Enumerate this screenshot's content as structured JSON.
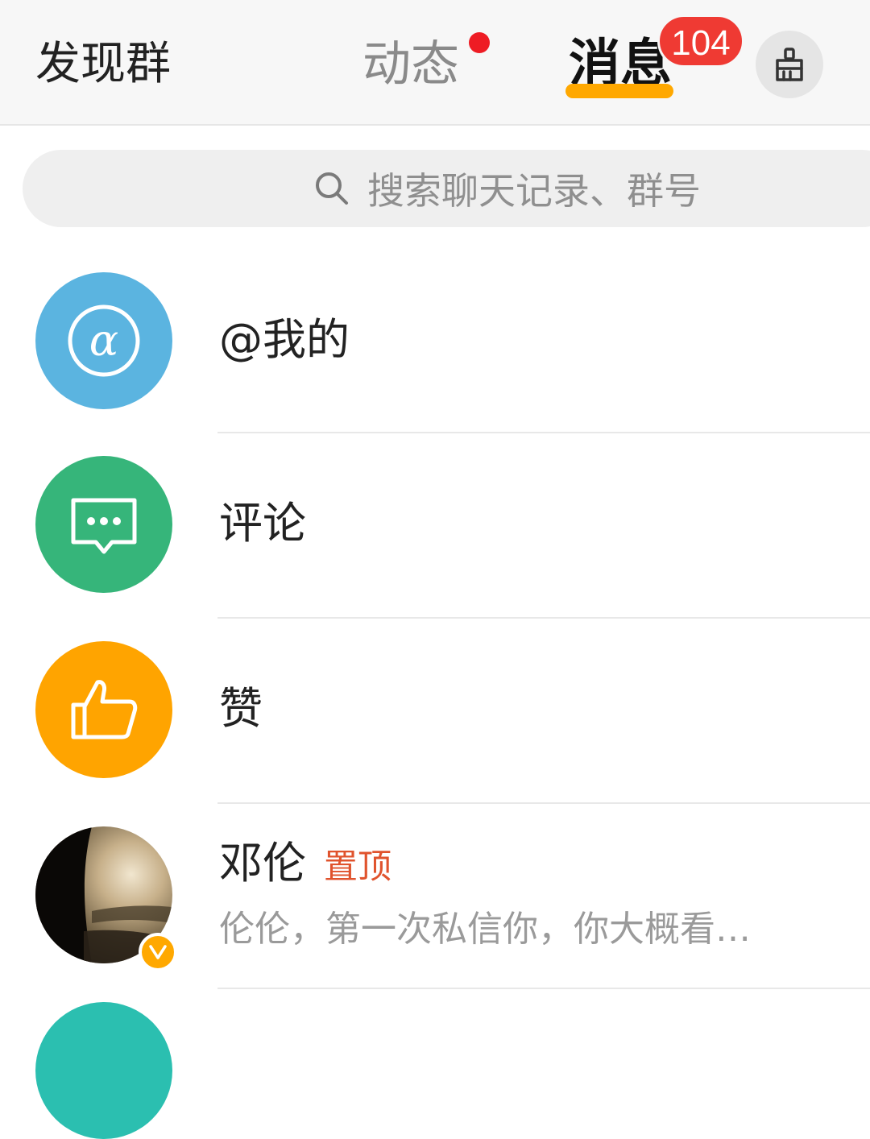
{
  "header": {
    "discover_label": "发现群",
    "tabs": [
      {
        "label": "动态",
        "has_dot": true
      },
      {
        "label": "消息",
        "selected": true,
        "badge": "104"
      }
    ],
    "clean_button_icon": "broom-icon"
  },
  "search": {
    "placeholder": "搜索聊天记录、群号",
    "icon": "search-icon"
  },
  "list": {
    "items": [
      {
        "title": "@我的",
        "icon": "at-icon",
        "color": "#5bb4e0"
      },
      {
        "title": "评论",
        "icon": "comment-icon",
        "color": "#36b57a"
      },
      {
        "title": "赞",
        "icon": "thumbs-up-icon",
        "color": "#ffa400"
      },
      {
        "title": "邓伦",
        "tag": "置顶",
        "preview": "伦伦，第一次私信你，你大概看…",
        "verified": true
      }
    ]
  },
  "colors": {
    "accent": "#ffa800",
    "badge": "#ef3a33",
    "pin": "#e0532d"
  }
}
